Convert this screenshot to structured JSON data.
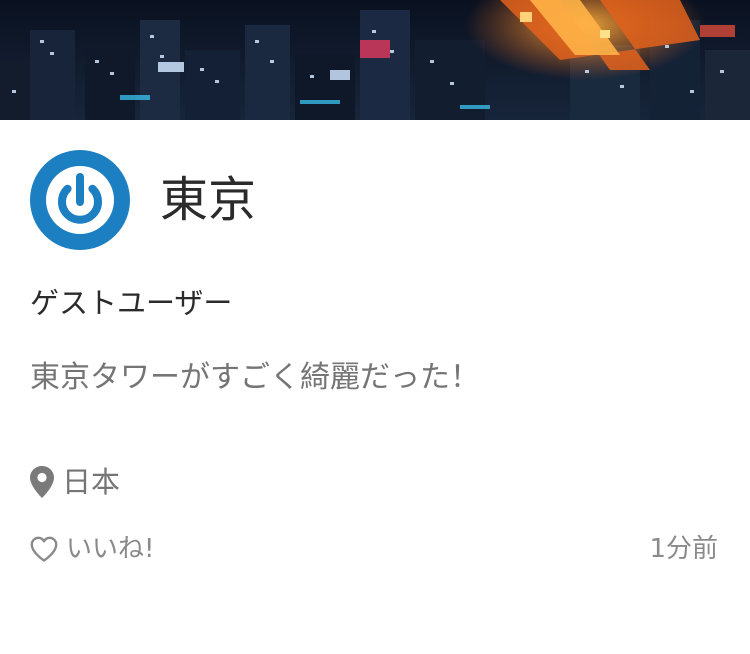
{
  "post": {
    "title": "東京",
    "username": "ゲストユーザー",
    "body": "東京タワーがすごく綺麗だった！",
    "location": "日本",
    "like_label": "いいね!",
    "timestamp": "1分前"
  },
  "icons": {
    "avatar": "power-icon",
    "location": "map-pin-icon",
    "like": "heart-outline-icon"
  },
  "colors": {
    "avatar_bg": "#1b7fc1",
    "primary_text": "#2b2b2b",
    "secondary_text": "#757575",
    "meta_text": "#8a8a8a"
  }
}
